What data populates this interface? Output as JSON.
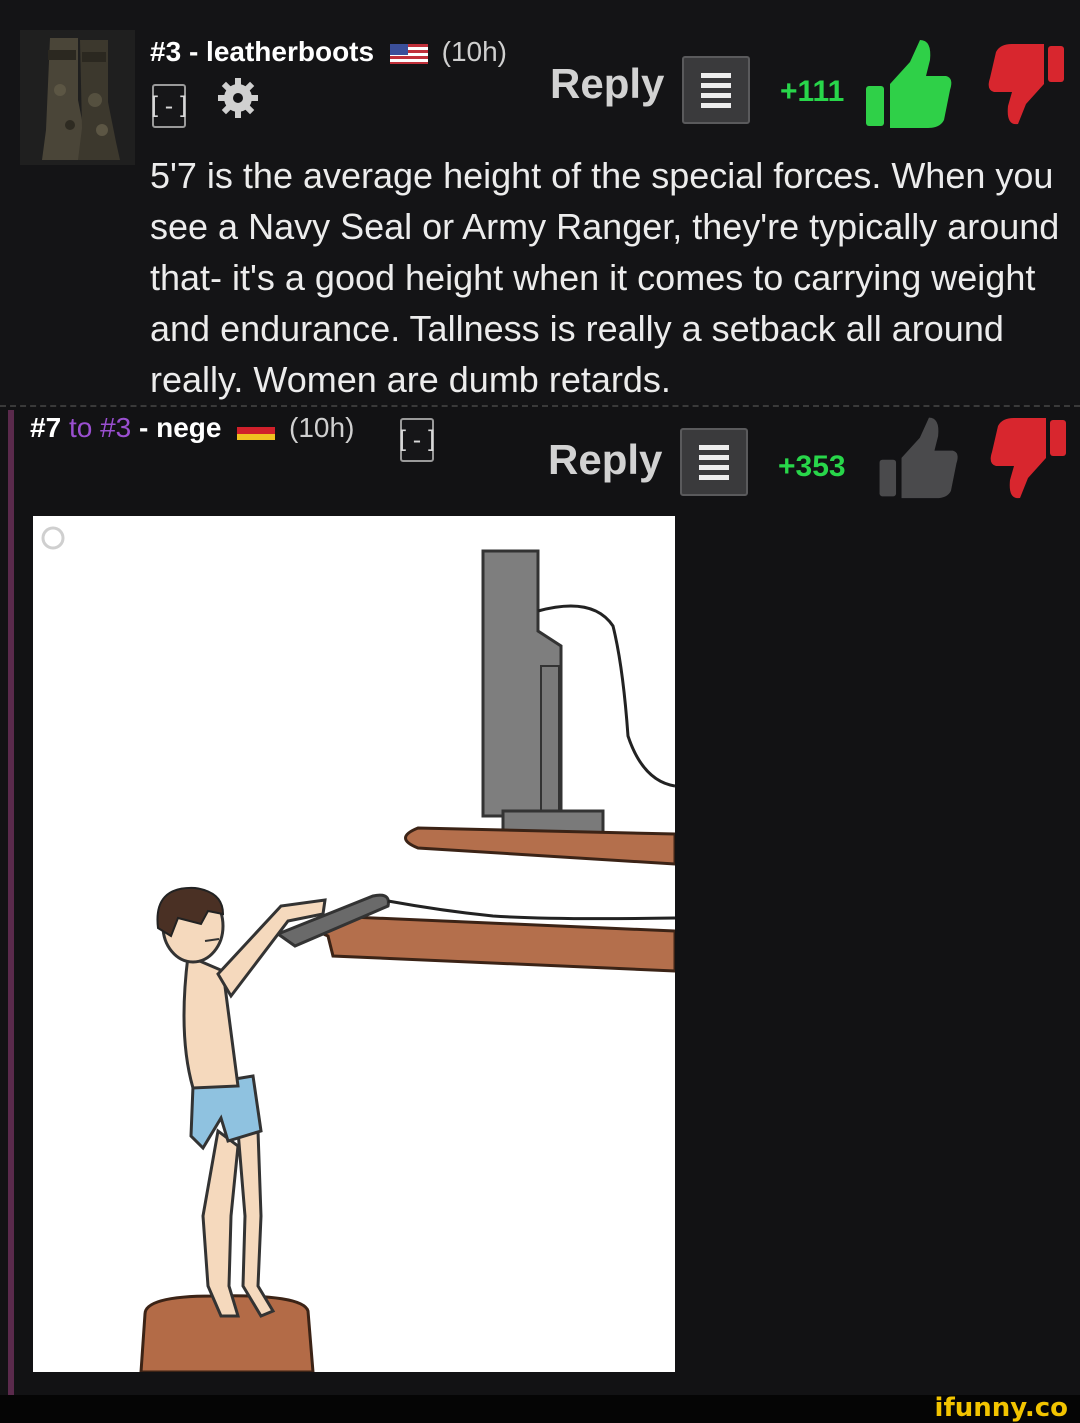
{
  "comment1": {
    "number": "#3",
    "separator": "-",
    "username": "leatherboots",
    "time": "(10h)",
    "collapse_label": "[-]",
    "reply_label": "Reply",
    "score": "+111",
    "body": "5'7 is the average height of the special forces. When you see a Navy Seal or Army Ranger, they're typically around that- it's a good height when it comes to carrying weight and endurance. Tallness is really a setback all around really. Women are dumb retards."
  },
  "comment2": {
    "number": "#7",
    "to_text": "to #3",
    "separator": "-",
    "username": "nege",
    "time": "(10h)",
    "collapse_label": "[-]",
    "reply_label": "Reply",
    "score": "+353"
  },
  "watermark": "ifunny.co",
  "colors": {
    "background": "#121214",
    "score_green": "#28d64a",
    "reply_link_purple": "#9a4fd0",
    "upvote_active": "#2fd048",
    "downvote": "#d8262e",
    "brand_yellow": "#f2c400"
  },
  "icons": [
    "avatar-boots-icon",
    "usa-flag-icon",
    "germany-flag-icon",
    "gear-icon",
    "menu-icon",
    "thumbs-up-icon",
    "thumbs-down-icon"
  ]
}
